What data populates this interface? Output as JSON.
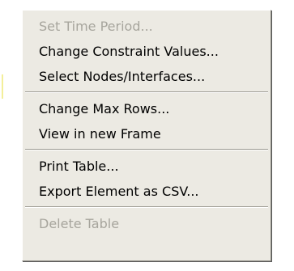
{
  "menu": {
    "items": [
      {
        "label": "Set Time Period...",
        "enabled": false
      },
      {
        "label": "Change Constraint Values...",
        "enabled": true
      },
      {
        "label": "Select Nodes/Interfaces...",
        "enabled": true
      },
      {
        "label": "Change Max Rows...",
        "enabled": true
      },
      {
        "label": "View in new Frame",
        "enabled": true
      },
      {
        "label": "Print Table...",
        "enabled": true
      },
      {
        "label": "Export Element as CSV...",
        "enabled": true
      },
      {
        "label": "Delete Table",
        "enabled": false
      }
    ]
  },
  "colors": {
    "menu_background": "#eceae3",
    "disabled_text": "#a7a59d",
    "enabled_text": "#000000"
  }
}
